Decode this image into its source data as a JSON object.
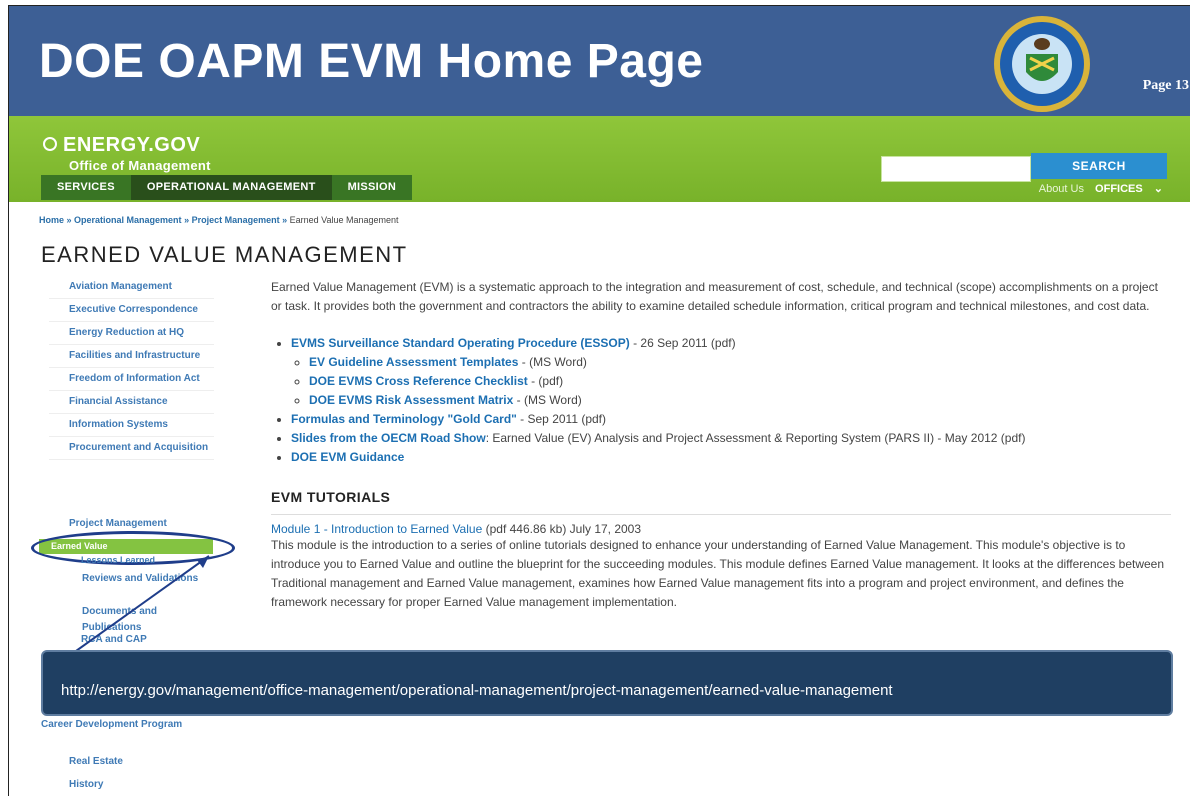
{
  "slide": {
    "title": "DOE OAPM EVM Home Page",
    "page_number": "Page 13"
  },
  "site": {
    "logo": "ENERGY.GOV",
    "office": "Office of Management",
    "search_button": "SEARCH",
    "search_value": "",
    "nav": [
      "SERVICES",
      "OPERATIONAL MANAGEMENT",
      "MISSION"
    ],
    "util_about": "About Us",
    "util_offices": "OFFICES",
    "util_offices_caret": "⌄"
  },
  "breadcrumb": {
    "items": [
      "Home",
      "Operational Management",
      "Project Management"
    ],
    "sep": " » ",
    "current": "Earned Value Management"
  },
  "page": {
    "heading": "EARNED VALUE MANAGEMENT"
  },
  "sidebar": {
    "items": [
      "Aviation Management",
      "Executive Correspondence",
      "Energy Reduction at HQ",
      "Facilities and Infrastructure",
      "Freedom of Information Act",
      "Financial Assistance",
      "Information Systems",
      "Procurement and Acquisition",
      "Project Management"
    ],
    "active": "Earned Value",
    "after": [
      "Lessons Learned",
      "Reviews and Validations",
      "Documents and Publications",
      "RCA and CAP"
    ],
    "bottom": [
      "Career Development Program",
      "Real Estate",
      "History"
    ]
  },
  "content": {
    "intro": "Earned Value Management (EVM) is a systematic approach to the integration and measurement of cost, schedule, and technical (scope) accomplishments on a project or task. It provides both the government and contractors the ability to examine detailed schedule information, critical program and technical milestones, and cost data.",
    "links": {
      "essop": {
        "link": "EVMS Surveillance Standard Operating Procedure (ESSOP)",
        "suffix": " - 26 Sep 2011 (pdf)"
      },
      "sub": [
        {
          "link": "EV Guideline Assessment Templates",
          "suffix": " - (MS Word)"
        },
        {
          "link": "DOE EVMS Cross Reference Checklist",
          "suffix": " - (pdf)"
        },
        {
          "link": "DOE EVMS Risk Assessment Matrix",
          "suffix": " - (MS Word)"
        }
      ],
      "gold": {
        "link": "Formulas and Terminology \"Gold Card\"",
        "suffix": " - Sep 2011 (pdf)"
      },
      "road": {
        "link": "Slides from the OECM Road Show",
        "suffix": ": Earned Value (EV) Analysis and Project Assessment & Reporting System (PARS II) - May 2012 (pdf)"
      },
      "guidance": {
        "link": "DOE EVM Guidance"
      }
    },
    "tutorials_heading": "EVM TUTORIALS",
    "module1": {
      "link": "Module 1 - Introduction to Earned Value",
      "meta": "(pdf 446.86 kb)  July 17, 2003",
      "desc": "This module is the introduction to a series of online tutorials designed to enhance your understanding of Earned Value Management. This module's objective is to introduce you to Earned Value and outline the blueprint for the succeeding modules. This module defines Earned Value management. It looks at the differences between Traditional management and Earned Value management, examines how Earned Value management fits into a program and project environment, and defines the framework necessary for proper Earned Value management implementation."
    }
  },
  "url_banner": "http://energy.gov/management/office-management/operational-management/project-management/earned-value-management",
  "colors": {
    "title_bar": "#3d5f95",
    "energy_green": "#7fb92f",
    "link_blue": "#1c6fb2",
    "banner": "#1f3f62"
  }
}
